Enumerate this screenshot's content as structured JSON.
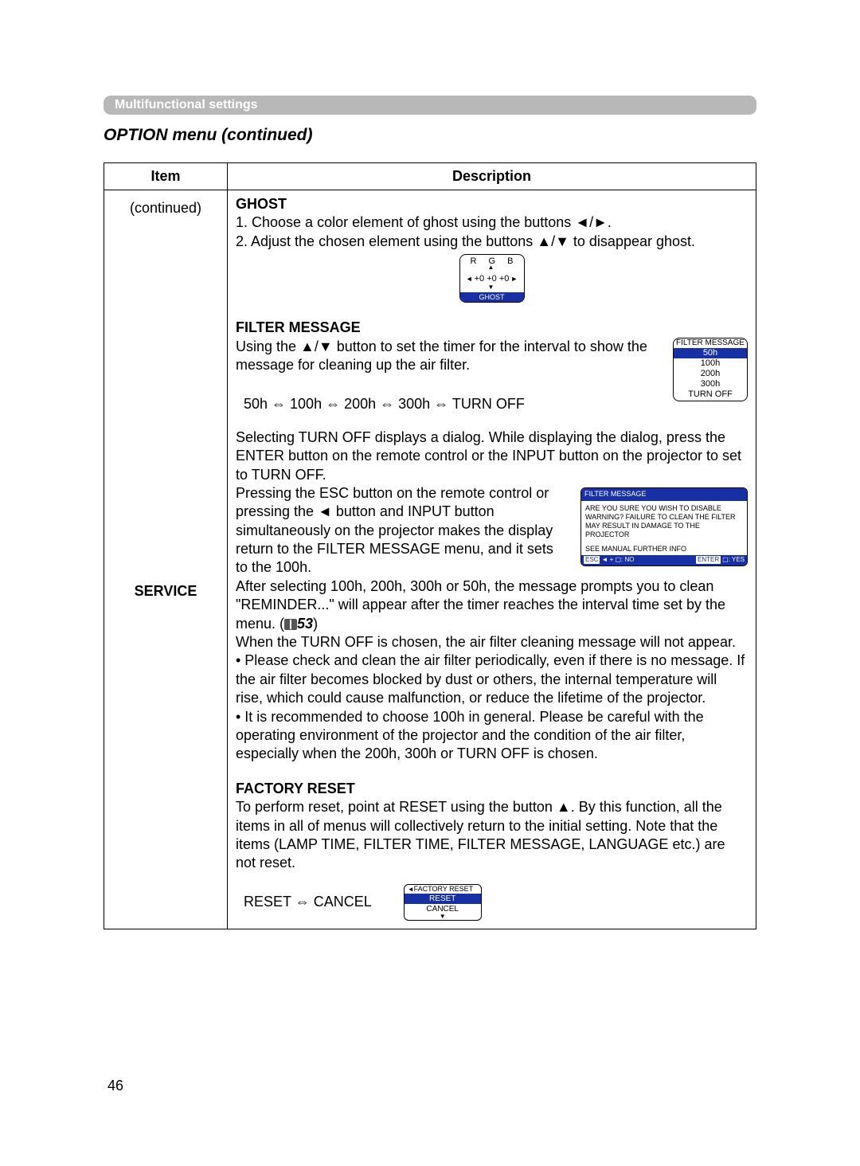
{
  "section_bar": "Multifunctional settings",
  "heading": "OPTION menu (continued)",
  "headers": {
    "item": "Item",
    "description": "Description"
  },
  "item_col": {
    "continued": "(continued)",
    "service": "SERVICE"
  },
  "ghost": {
    "title": "GHOST",
    "line1_a": "1. Choose a color element of ghost using the buttons ",
    "line1_b": "◄/►.",
    "line2_a": "2. Adjust the chosen element using the buttons ",
    "line2_b": "▲/▼",
    "line2_c": " to disappear ghost.",
    "graphic": {
      "rgb": "R   G   B",
      "vals": "+0  +0  +0",
      "left": "◄",
      "right": "►",
      "up": "▲",
      "down": "▼",
      "label": "GHOST"
    }
  },
  "filter_msg": {
    "title": "FILTER MESSAGE",
    "line_a": "Using the ",
    "line_b": "▲/▼",
    "line_c": " button to set the timer for the interval to show the message for cleaning up the air filter.",
    "seq": "50h ⇔ 100h ⇔ 200h ⇔ 300h ⇔ TURN OFF",
    "listbox": {
      "title": "FILTER MESSAGE",
      "items": [
        "50h",
        "100h",
        "200h",
        "300h",
        "TURN OFF"
      ],
      "selected_index": 0
    },
    "turnoff_para": "Selecting TURN OFF displays a dialog. While displaying the dialog, press the ENTER button on the remote control or the INPUT button on the projector to set to TURN OFF.",
    "esc_para": "Pressing the ESC button on the remote control or pressing the ◄ button and INPUT button simultaneously on the projector makes the display return to the FILTER MESSAGE menu, and it sets to the 100h.",
    "dialog": {
      "title": "FILTER MESSAGE",
      "body1": "ARE YOU SURE YOU WISH TO DISABLE WARNING? FAILURE TO CLEAN THE FILTER MAY RESULT IN DAMAGE TO THE PROJECTOR",
      "body2": "SEE MANUAL FURTHER INFO",
      "esc": "ESC",
      "no": ": NO",
      "enter": "ENTER",
      "yes": ": YES"
    },
    "after100_a": "After selecting 100h, 200h, 300h or 50h, the message prompts you to clean \"REMINDER...\" will appear after the timer reaches the interval time set by the menu. (",
    "ref53": "53",
    "after100_b": ")",
    "turnoff_no_msg": "When the TURN OFF is chosen, the air filter cleaning message will not appear.",
    "bullet1": "• Please check and clean the air filter periodically, even if there is no message. If the air filter becomes blocked by dust or others, the internal temperature will rise, which could cause malfunction, or reduce the lifetime of the projector.",
    "bullet2": "• It is recommended to choose 100h in general. Please be careful with the operating environment of the projector and the condition of the air filter, especially when the 200h, 300h or TURN OFF is chosen."
  },
  "factory_reset": {
    "title": "FACTORY RESET",
    "para_a": "To perform reset, point at RESET using the button ",
    "para_b": "▲",
    "para_c": ". By this function, all the items in all of menus will collectively return to the initial setting. Note that the items (LAMP TIME, FILTER TIME, FILTER MESSAGE, LANGUAGE etc.) are not reset.",
    "seq": "RESET ⇔ CANCEL",
    "box": {
      "title": "FACTORY RESET",
      "reset": "RESET",
      "cancel": "CANCEL",
      "left": "◄",
      "down": "▼"
    }
  },
  "page_num": "46"
}
